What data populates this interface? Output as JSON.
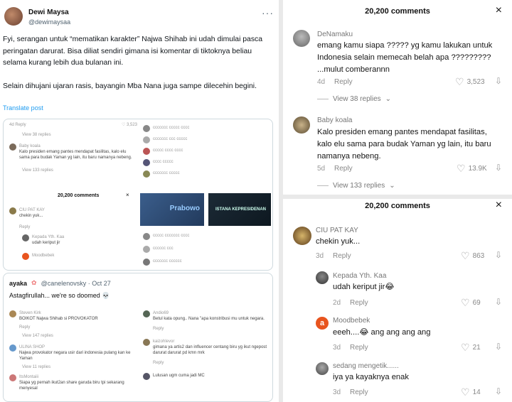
{
  "tweet": {
    "display_name": "Dewi Maysa",
    "handle": "@dewimaysaa",
    "more": "···",
    "paragraph1": "Fyi, serangan untuk “mematikan karakter” Najwa Shihab ini udah dimulai pasca peringatan darurat. Bisa diliat sendiri gimana isi komentar di tiktoknya beliau selama kurang lebih dua bulanan ini.",
    "paragraph2": "Selain dihujani ujaran rasis, bayangin Mba Nana juga sampe dilecehin begini.",
    "translate": "Translate post"
  },
  "embedded1": {
    "header": "20,200 comments",
    "close": "×",
    "view38": "View 38 replies",
    "baby_name": "Baby koala",
    "baby_text": "Kalo presiden emang pantes mendapat fasilitas, kalo elu sama para budak Yaman yg lain, itu baru namanya nebeng.",
    "view133": "View 133 replies",
    "ciu_name": "CIU PAT KAY",
    "ciu_text": "chekin yuk...",
    "reply": "Reply",
    "kepada_name": "Kepada Yth. Kaa",
    "kepada_text": "udah keriput jir",
    "mood_name": "Moodbebek",
    "news1": "Prabowo",
    "news2": "ISTANA KEPRESIDENAN"
  },
  "embedded2": {
    "author": "ayaka",
    "author_handle": "@canelenovsky · Oct 27",
    "text": "Astagfirullah... we're so doomed",
    "c1_name": "Steven Kirk",
    "c1_text": "BOIKOT Najwa Shihab si PROVOKATOR",
    "c2_name": "ULINA SHOP",
    "c2_text": "Najwa provokator negara usir dari indonesia pulang kan ke Yaman",
    "c3_name": "ItsMontaiii",
    "c3_text": "Siapa yg pernah ikut2an share garuda biru tpi sekarang menyesal",
    "r1_name": "Andio69",
    "r1_text": "Betul kata opung.. Nana \"apa konstribusi mu untuk negara.",
    "r2_name": "kaizohlevor",
    "r2_text": "gimana ya artis2 dan influencer centang biru yg ikut ngepost darurat darurat pd kmn mrk",
    "r3_text": "Lulusan ugm cuma jadi MC",
    "view_replies": "View 147 replies",
    "view11": "View 11 replies",
    "reply": "Reply"
  },
  "tiktok": {
    "top": {
      "header": "20,200 comments",
      "close": "×",
      "comments": [
        {
          "name": "DeNamaku",
          "text": "emang kamu siapa ????? yg kamu lakukan untuk Indonesia selain memecah belah apa ????????? ...mulut comberannn",
          "time": "4d",
          "reply": "Reply",
          "likes": "3,523",
          "view_replies": "View 38 replies"
        },
        {
          "name": "Baby koala",
          "text": "Kalo presiden emang pantes mendapat fasilitas, kalo elu sama para budak Yaman yg lain, itu baru namanya nebeng.",
          "time": "5d",
          "reply": "Reply",
          "likes": "13.9K",
          "view_replies": "View 133 replies"
        }
      ]
    },
    "bottom": {
      "header": "20,200 comments",
      "close": "×",
      "main": {
        "name": "CIU PAT KAY",
        "text": "chekin yuk...",
        "time": "3d",
        "reply": "Reply",
        "likes": "863"
      },
      "replies": [
        {
          "name": "Kepada Yth. Kaa",
          "text": "udah keriput jir",
          "emoji": "😂",
          "time": "2d",
          "reply": "Reply",
          "likes": "69"
        },
        {
          "name": "Moodbebek",
          "text": "eeeh....",
          "emoji": "😂",
          "text2": " ang ang ang ang",
          "time": "3d",
          "reply": "Reply",
          "likes": "21"
        },
        {
          "name": "sedang mengetik......",
          "text": "iya ya kayaknya enak",
          "time": "3d",
          "reply": "Reply",
          "likes": "14"
        }
      ]
    }
  },
  "colors": {
    "link": "#1d9bf0",
    "heart_gray": "#999999",
    "moodbebek_avatar": "#e8541e"
  }
}
